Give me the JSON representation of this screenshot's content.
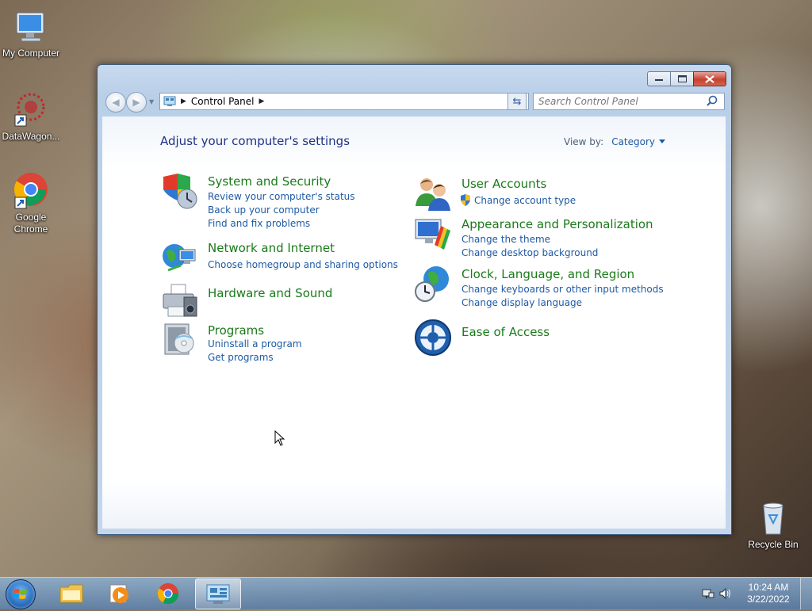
{
  "desktop": {
    "icons": [
      {
        "label": "My Computer"
      },
      {
        "label": "DataWagon..."
      },
      {
        "label": "Google Chrome"
      },
      {
        "label": "Recycle Bin"
      }
    ]
  },
  "window": {
    "address": {
      "crumb": "Control Panel"
    },
    "search": {
      "placeholder": "Search Control Panel"
    },
    "heading": "Adjust your computer's settings",
    "view_by": {
      "label": "View by:",
      "value": "Category"
    },
    "categories": [
      {
        "title": "System and Security",
        "icon": "shield-icon",
        "links": [
          "Review your computer's status",
          "Back up your computer",
          "Find and fix problems"
        ]
      },
      {
        "title": "Network and Internet",
        "icon": "network-globe-icon",
        "links": [
          "Choose homegroup and sharing options"
        ]
      },
      {
        "title": "Hardware and Sound",
        "icon": "printer-icon",
        "links": []
      },
      {
        "title": "Programs",
        "icon": "programs-icon",
        "links": [
          "Uninstall a program",
          "Get programs"
        ]
      },
      {
        "title": "User Accounts",
        "icon": "users-icon",
        "links": [
          "Change account type"
        ]
      },
      {
        "title": "Appearance and Personalization",
        "icon": "monitor-palette-icon",
        "links": [
          "Change the theme",
          "Change desktop background"
        ]
      },
      {
        "title": "Clock, Language, and Region",
        "icon": "clock-globe-icon",
        "links": [
          "Change keyboards or other input methods",
          "Change display language"
        ]
      },
      {
        "title": "Ease of Access",
        "icon": "ease-of-access-icon",
        "links": []
      }
    ]
  },
  "taskbar": {
    "items": [
      "start-orb",
      "explorer",
      "media-player",
      "chrome",
      "control-panel"
    ],
    "clock": {
      "time": "10:24 AM",
      "date": "3/22/2022"
    }
  }
}
